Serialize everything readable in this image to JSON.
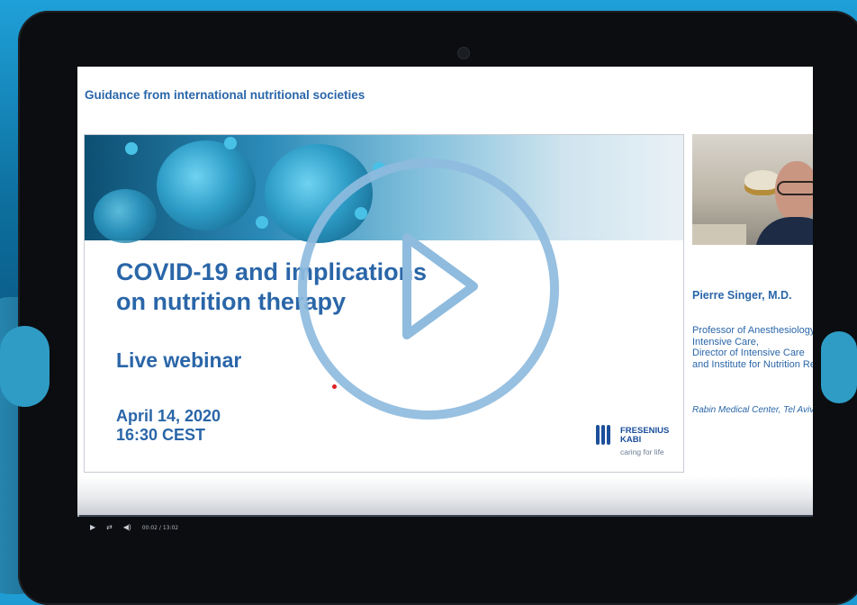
{
  "slide": {
    "heading": "Guidance from international nutritional societies",
    "title_line1": "COVID-19 and implications",
    "title_line2": "on nutrition therapy",
    "subtitle": "Live webinar",
    "date": "April 14, 2020",
    "time": "16:30 CEST",
    "logo_line1": "FRESENIUS",
    "logo_line2": "KABI",
    "logo_tagline": "caring for life"
  },
  "presenter": {
    "name": "Pierre Singer, M.D.",
    "role": "Professor of Anesthesiology and\nIntensive Care,\nDirector of Intensive Care\nand Institute for Nutrition Research",
    "institution": "Rabin Medical Center, Tel Aviv"
  },
  "player": {
    "time_display": "00:02 / 13:02",
    "progress": 0.0025,
    "icons": {
      "play": "play-icon",
      "loop": "loop-icon",
      "volume": "volume-icon",
      "overlay": "play-overlay-icon"
    },
    "colors": {
      "overlay_accent": "#8ebbde",
      "slide_blue": "#2a66a8"
    }
  }
}
